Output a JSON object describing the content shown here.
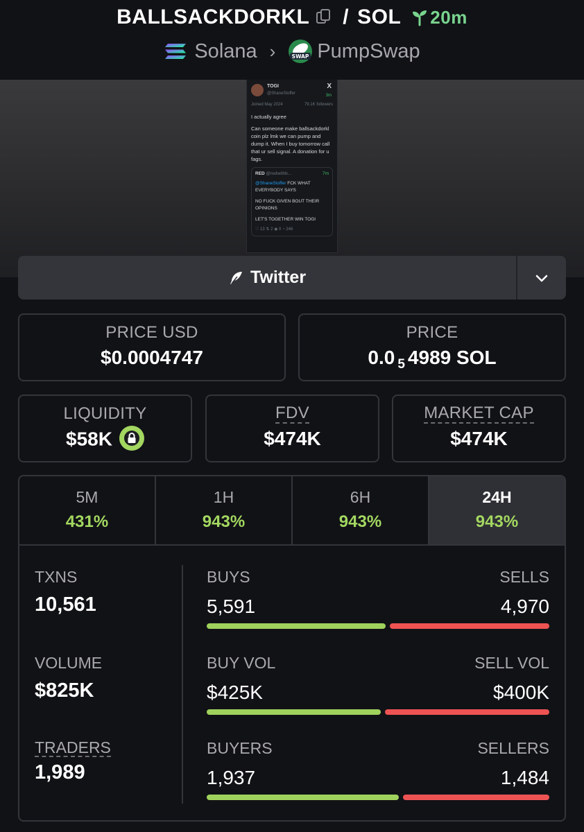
{
  "header": {
    "token": "BALLSACKDORKL",
    "separator": "/",
    "quote": "SOL",
    "age": "20m",
    "chain": "Solana",
    "dex": "PumpSwap",
    "icons": [
      "copy-icon",
      "sprout-icon",
      "solana-logo",
      "chevron-right-icon",
      "pumpswap-logo"
    ]
  },
  "tweet": {
    "name": "TOGI",
    "handle": "@ShaneStoffer",
    "time": "3m",
    "joined": "Joined May 2024",
    "followers": "79.1K followers",
    "line1": "I actually agree",
    "body": "Can someone make ballsackdorkl coin plz lmk we can pump and dump it. When I buy tomorrow call that ur sell signal. A donation for u fags.",
    "quote": {
      "name": "RED",
      "handle": "@redwithb...",
      "time": "7m",
      "mention": "@ShaneStoffer",
      "text1": "FCK WHAT EVERYBODY SAYS",
      "text2": "NO FUCK GIVEN BOUT THEIR OPINIONS",
      "text3": "LET'S TOGETHER WIN TOGI",
      "stats": "♡ 13   ⇅ 2   ◉ 0   ◔ 246"
    }
  },
  "twitter_button": {
    "label": "Twitter"
  },
  "price": {
    "usd_label": "PRICE USD",
    "usd_value": "$0.0004747",
    "native_label": "PRICE",
    "native_prefix": "0.0",
    "native_zeros": "5",
    "native_suffix": "4989 SOL"
  },
  "stats": {
    "liquidity_label": "LIQUIDITY",
    "liquidity_value": "$58K",
    "fdv_label": "FDV",
    "fdv_value": "$474K",
    "mcap_label": "MARKET CAP",
    "mcap_value": "$474K"
  },
  "timeframes": [
    {
      "label": "5M",
      "change": "431%"
    },
    {
      "label": "1H",
      "change": "943%"
    },
    {
      "label": "6H",
      "change": "943%"
    },
    {
      "label": "24H",
      "change": "943%"
    }
  ],
  "metrics": {
    "txns_label": "TXNS",
    "txns_value": "10,561",
    "volume_label": "VOLUME",
    "volume_value": "$825K",
    "traders_label": "TRADERS",
    "traders_value": "1,989",
    "buys_label": "BUYS",
    "buys_value": "5,591",
    "sells_label": "SELLS",
    "sells_value": "4,970",
    "buy_vol_label": "BUY VOL",
    "buy_vol_value": "$425K",
    "sell_vol_label": "SELL VOL",
    "sell_vol_value": "$400K",
    "buyers_label": "BUYERS",
    "buyers_value": "1,937",
    "sellers_label": "SELLERS",
    "sellers_value": "1,484",
    "buy_ratio": {
      "txns": 0.529,
      "volume": 0.515,
      "makers": 0.566
    }
  },
  "colors": {
    "positive": "#a3d760",
    "negative": "#ee5353",
    "age": "#79d48e",
    "background": "#111216",
    "card_border": "#34353a"
  }
}
